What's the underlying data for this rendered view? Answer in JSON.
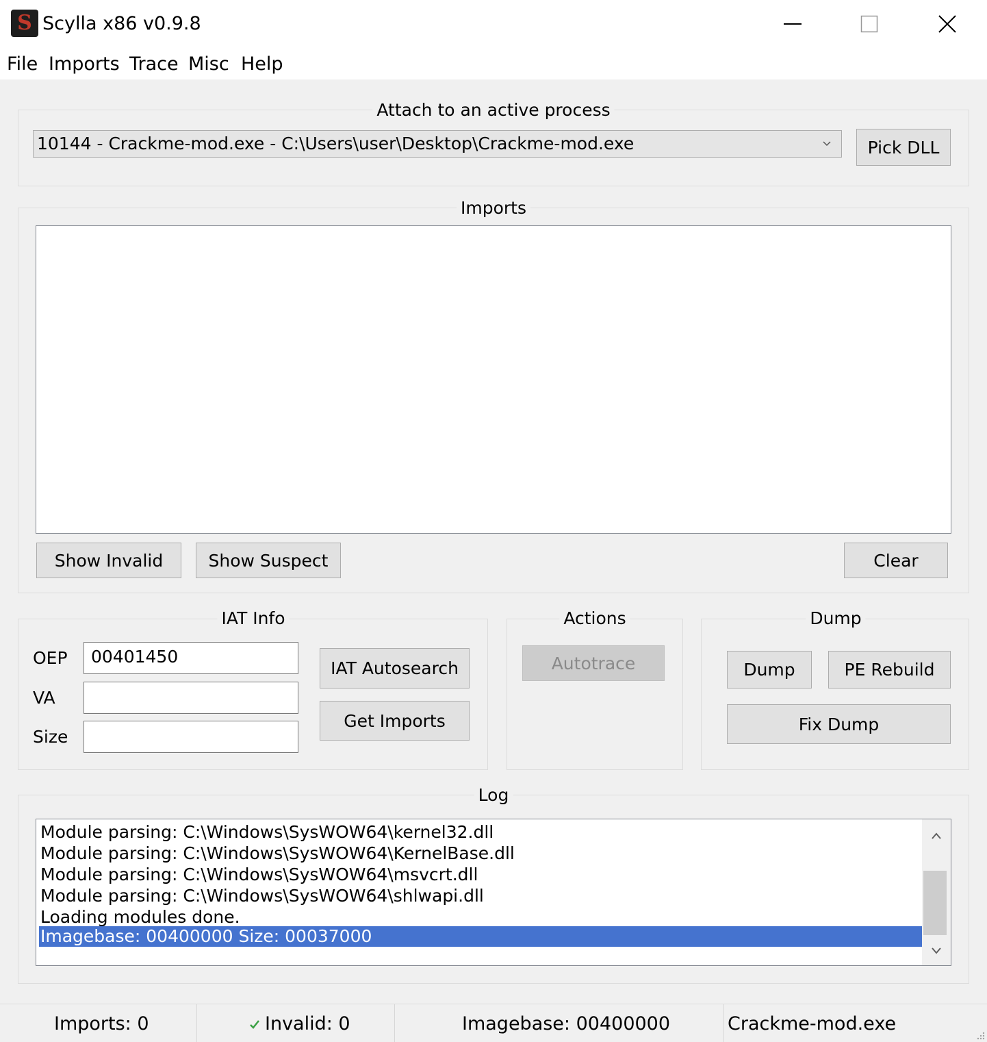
{
  "window": {
    "title": "Scylla x86 v0.9.8",
    "app_icon_letter": "S"
  },
  "menu": [
    "File",
    "Imports",
    "Trace",
    "Misc",
    "Help"
  ],
  "attach": {
    "title": "Attach to an active process",
    "process_selected": "10144 - Crackme-mod.exe - C:\\Users\\user\\Desktop\\Crackme-mod.exe",
    "pick_dll": "Pick DLL"
  },
  "imports": {
    "title": "Imports",
    "show_invalid": "Show Invalid",
    "show_suspect": "Show Suspect",
    "clear": "Clear"
  },
  "iat_info": {
    "title": "IAT Info",
    "oep_label": "OEP",
    "oep_value": "00401450",
    "va_label": "VA",
    "va_value": "",
    "size_label": "Size",
    "size_value": "",
    "autosearch": "IAT Autosearch",
    "get_imports": "Get Imports"
  },
  "actions": {
    "title": "Actions",
    "autotrace": "Autotrace"
  },
  "dump": {
    "title": "Dump",
    "dump": "Dump",
    "pe_rebuild": "PE Rebuild",
    "fix_dump": "Fix Dump"
  },
  "log": {
    "title": "Log",
    "lines": [
      "Module parsing: C:\\Windows\\SysWOW64\\kernel32.dll",
      "Module parsing: C:\\Windows\\SysWOW64\\KernelBase.dll",
      "Module parsing: C:\\Windows\\SysWOW64\\msvcrt.dll",
      "Module parsing: C:\\Windows\\SysWOW64\\shlwapi.dll",
      "Loading modules done.",
      "Imagebase: 00400000 Size: 00037000"
    ],
    "selected_index": 5
  },
  "status": {
    "imports": "Imports: 0",
    "invalid": "Invalid: 0",
    "imagebase": "Imagebase: 00400000",
    "module": "Crackme-mod.exe"
  },
  "colors": {
    "selection": "#4573cf",
    "check": "#3aa043"
  }
}
